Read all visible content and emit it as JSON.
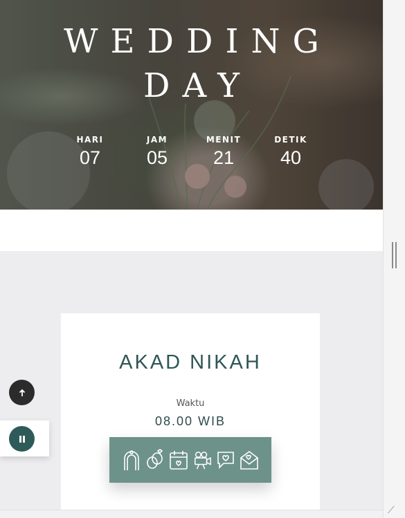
{
  "hero": {
    "title_line1": "WEDDING",
    "title_line2": "DAY",
    "countdown": [
      {
        "label": "HARI",
        "value": "07"
      },
      {
        "label": "JAM",
        "value": "05"
      },
      {
        "label": "MENIT",
        "value": "21"
      },
      {
        "label": "DETIK",
        "value": "40"
      }
    ]
  },
  "event": {
    "title": "AKAD NIKAH",
    "time_label": "Waktu",
    "time_value": "08.00 WIB",
    "icons": [
      "arch-icon",
      "rings-icon",
      "calendar-icon",
      "video-camera-icon",
      "love-chat-icon",
      "love-letter-icon"
    ]
  },
  "controls": {
    "scroll_top_icon": "arrow-up-icon",
    "music_icon": "pause-icon"
  },
  "colors": {
    "accent": "#2f5a5a",
    "icon_bar": "#6d928a",
    "heading": "#2f5555"
  }
}
